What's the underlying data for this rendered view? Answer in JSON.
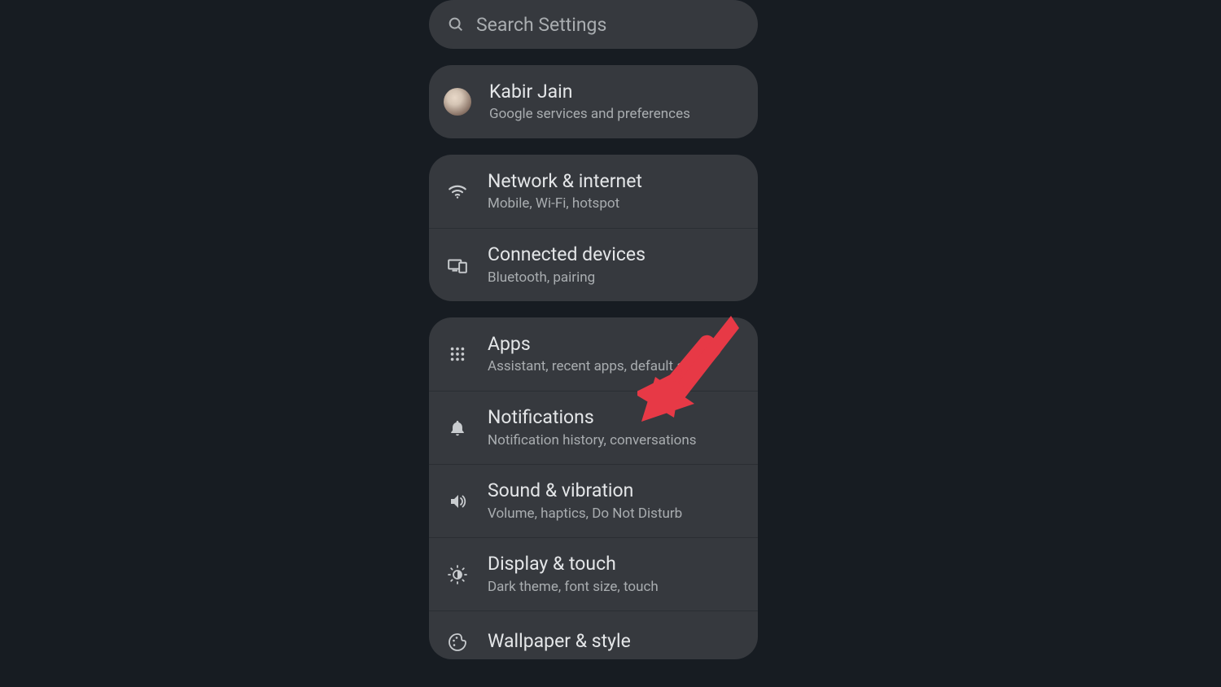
{
  "search": {
    "placeholder": "Search Settings"
  },
  "account": {
    "name": "Kabir Jain",
    "subtitle": "Google services and preferences"
  },
  "group1": [
    {
      "icon": "wifi-icon",
      "title": "Network & internet",
      "subtitle": "Mobile, Wi-Fi, hotspot"
    },
    {
      "icon": "devices-icon",
      "title": "Connected devices",
      "subtitle": "Bluetooth, pairing"
    }
  ],
  "group2": [
    {
      "icon": "apps-icon",
      "title": "Apps",
      "subtitle": "Assistant, recent apps, default apps"
    },
    {
      "icon": "notifications-icon",
      "title": "Notifications",
      "subtitle": "Notification history, conversations"
    },
    {
      "icon": "sound-icon",
      "title": "Sound & vibration",
      "subtitle": "Volume, haptics, Do Not Disturb"
    },
    {
      "icon": "display-icon",
      "title": "Display & touch",
      "subtitle": "Dark theme, font size, touch"
    },
    {
      "icon": "palette-icon",
      "title": "Wallpaper & style",
      "subtitle": ""
    }
  ],
  "annotation": {
    "target": "notifications",
    "color": "#e73946"
  }
}
